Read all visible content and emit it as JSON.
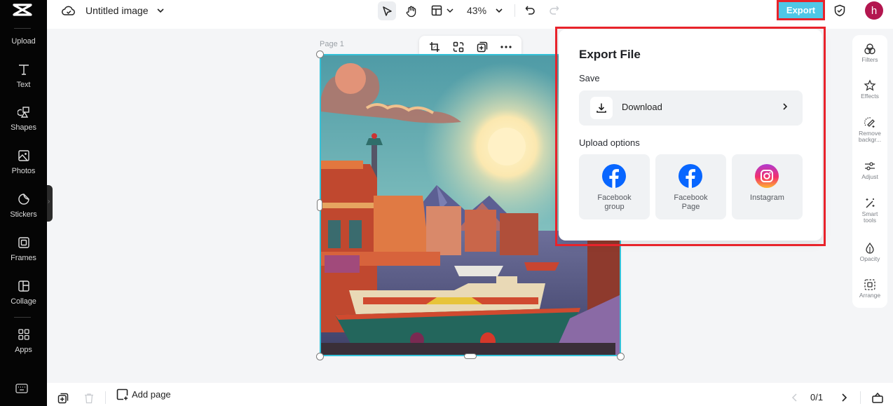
{
  "sidebar": {
    "logo": "capcut-logo",
    "items": [
      {
        "label": "Upload",
        "icon": "upload-icon"
      },
      {
        "label": "Text",
        "icon": "text-icon"
      },
      {
        "label": "Shapes",
        "icon": "shapes-icon"
      },
      {
        "label": "Photos",
        "icon": "photos-icon"
      },
      {
        "label": "Stickers",
        "icon": "stickers-icon"
      },
      {
        "label": "Frames",
        "icon": "frames-icon"
      },
      {
        "label": "Collage",
        "icon": "collage-icon"
      },
      {
        "label": "Apps",
        "icon": "apps-icon"
      }
    ],
    "bottom_icon": "keyboard-icon"
  },
  "header": {
    "cloud_icon": "cloud-sync-icon",
    "title": "Untitled image",
    "zoom": "43%",
    "export_label": "Export",
    "avatar_initial": "h",
    "avatar_color": "#b3164f"
  },
  "canvas": {
    "page_label": "Page 1",
    "image_description": "Illustrated harbor town with boats, mountains and sun",
    "selection_color": "#34c1d8"
  },
  "export_panel": {
    "title": "Export File",
    "save_label": "Save",
    "download_label": "Download",
    "upload_options_label": "Upload options",
    "upload_options": [
      {
        "label": "Facebook group",
        "icon": "facebook-icon"
      },
      {
        "label": "Facebook Page",
        "icon": "facebook-icon"
      },
      {
        "label": "Instagram",
        "icon": "instagram-icon"
      }
    ],
    "highlight_color": "#e8232b"
  },
  "right_panel": {
    "items": [
      {
        "label": "Filters"
      },
      {
        "label": "Effects"
      },
      {
        "label": "Remove backgr..."
      },
      {
        "label": "Adjust"
      },
      {
        "label": "Smart tools"
      },
      {
        "label": "Opacity"
      },
      {
        "label": "Arrange"
      }
    ]
  },
  "footer": {
    "add_page_label": "Add page",
    "page_count": "0/1"
  }
}
